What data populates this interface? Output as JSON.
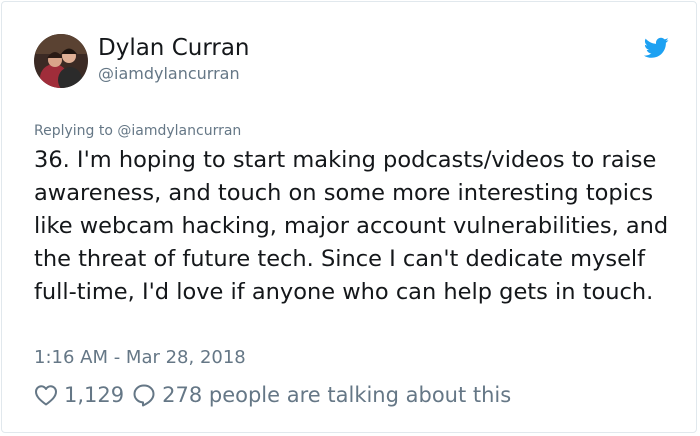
{
  "tweet": {
    "author_name": "Dylan Curran",
    "author_handle": "@iamdylancurran",
    "replying_prefix": "Replying to ",
    "replying_to": "@iamdylancurran",
    "text": "36. I'm hoping to start making podcasts/videos to raise awareness, and touch on some more interesting topics like webcam hacking, major account vulnerabilities, and the threat of future tech. Since I can't dedicate myself full-time, I'd love if anyone who can help gets in touch.",
    "timestamp": "1:16 AM - Mar 28, 2018",
    "like_count": "1,129",
    "talking_text": "278 people are talking about this"
  },
  "colors": {
    "twitter_blue": "#1da1f2",
    "text_primary": "#14171a",
    "text_secondary": "#657786",
    "border": "#e1e8ed"
  },
  "icons": {
    "brand": "twitter-bird-icon",
    "like": "heart-icon",
    "reply": "speech-bubble-icon"
  }
}
